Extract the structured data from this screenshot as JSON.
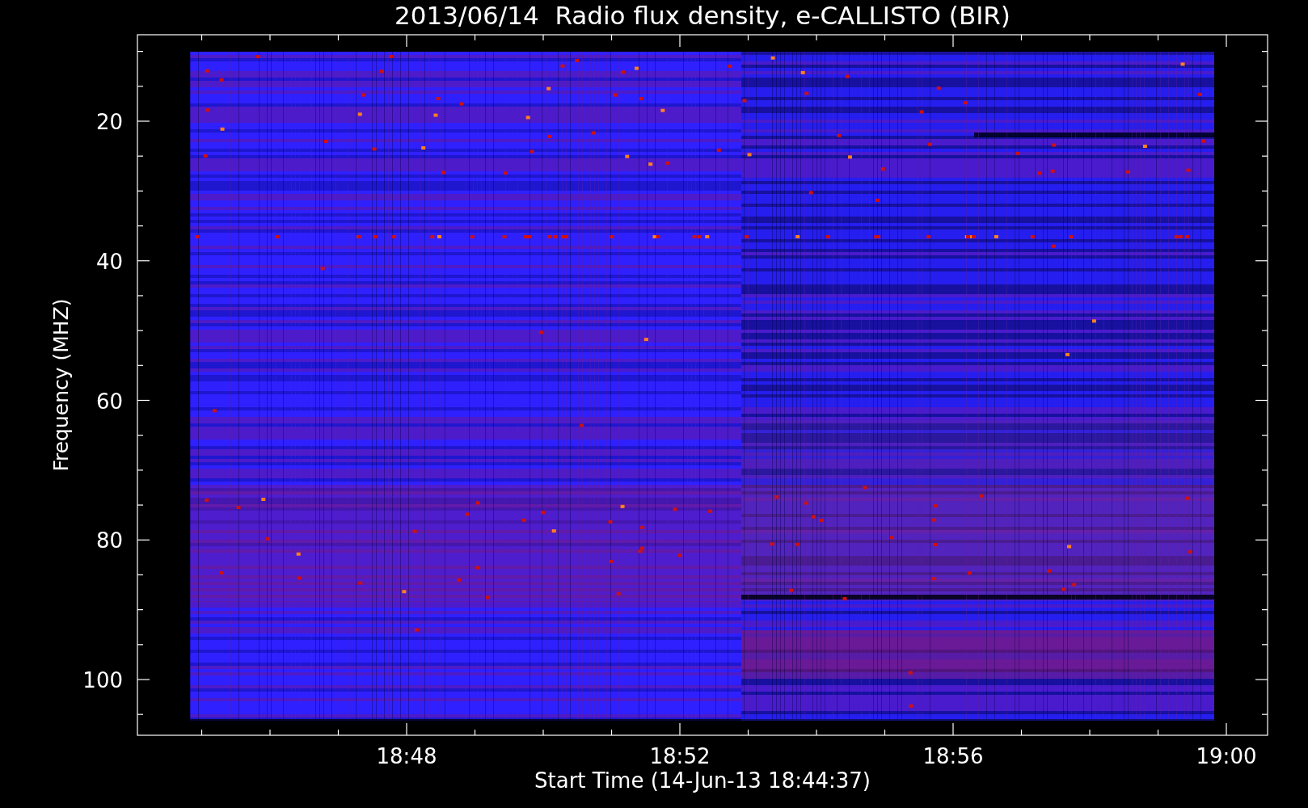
{
  "title": "2013/06/14  Radio flux density, e-CALLISTO (BIR)",
  "y_axis": {
    "label": "Frequency (MHZ)",
    "ticks": [
      "20",
      "40",
      "60",
      "80",
      "100"
    ]
  },
  "x_axis": {
    "label": "Start Time (14-Jun-13 18:44:37)",
    "ticks": [
      "18:48",
      "18:52",
      "18:56",
      "19:00"
    ]
  }
}
